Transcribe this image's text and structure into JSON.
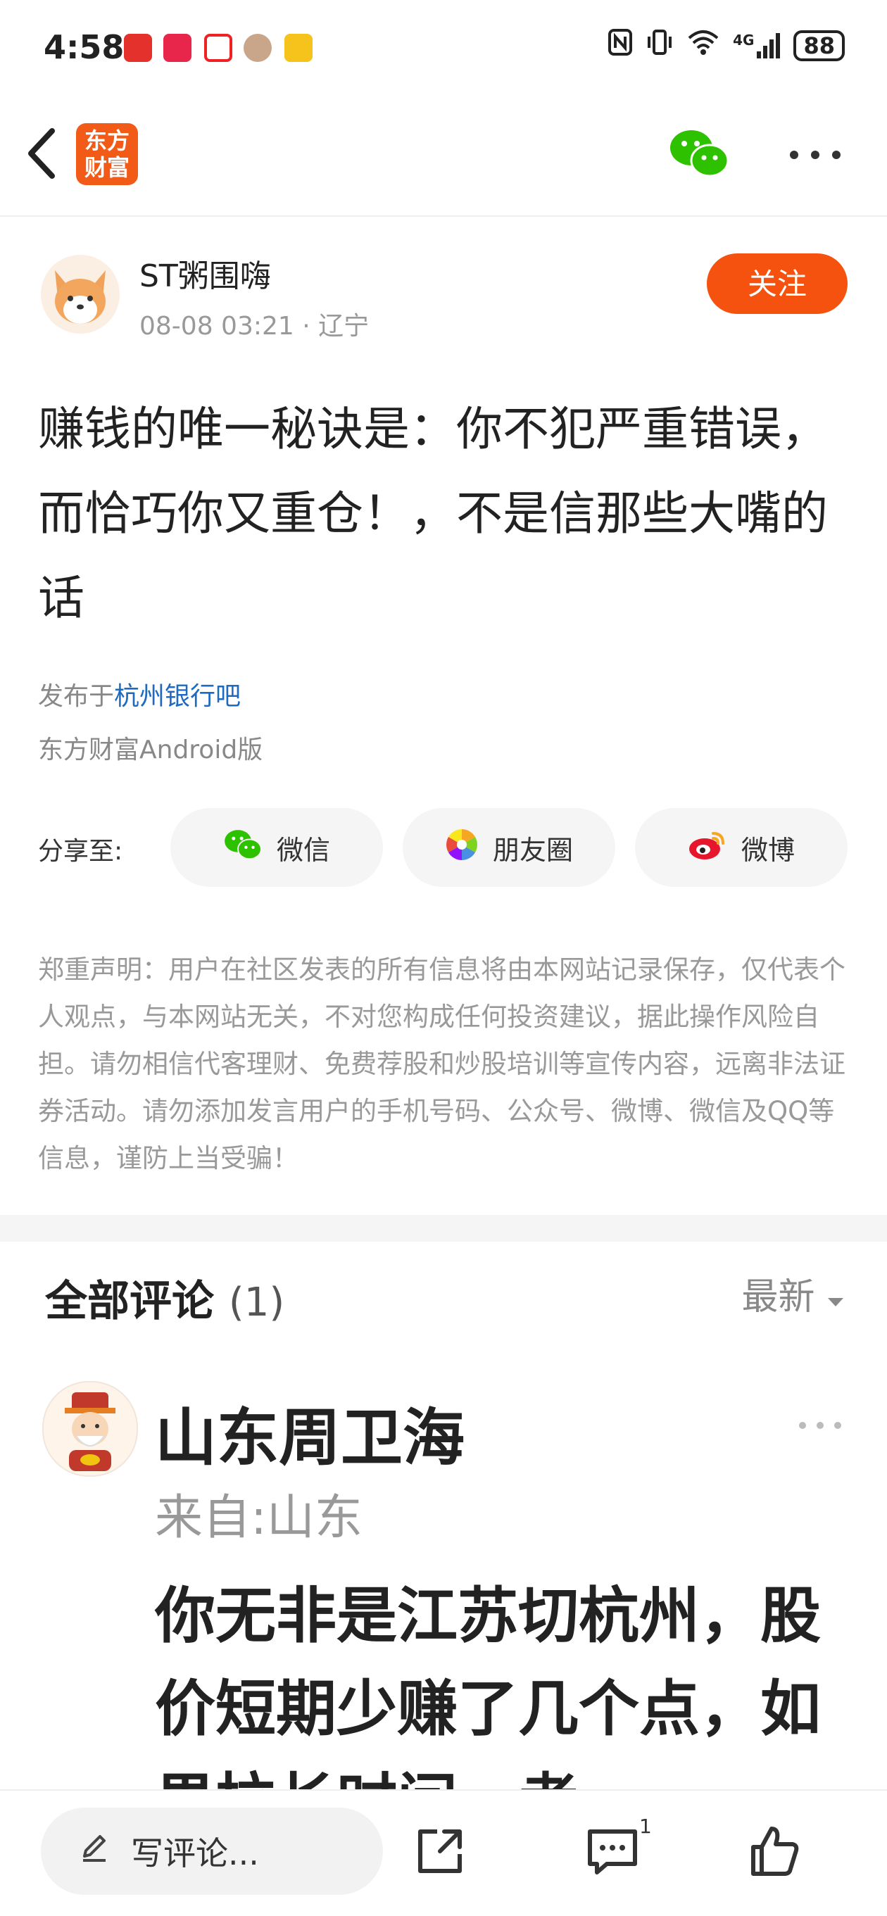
{
  "status_bar": {
    "time": "4:58",
    "battery": "88",
    "network": "4G",
    "icons": [
      "stock-app-icon",
      "hongbao-app-icon",
      "video-app-icon",
      "avatar-app-icon",
      "weibo-app-icon",
      "nfc-icon",
      "vibrate-icon",
      "wifi-icon",
      "signal-icon",
      "battery-icon"
    ]
  },
  "header": {
    "logo_line1": "东方",
    "logo_line2": "财富",
    "icons": [
      "back-icon",
      "wechat-icon",
      "more-icon"
    ]
  },
  "author": {
    "name": "ST粥围嗨",
    "meta": "08-08 03:21 · 辽宁",
    "follow_label": "关注"
  },
  "post": {
    "text": "赚钱的唯一秘诀是：你不犯严重错误，而恰巧你又重仓！，不是信那些大嘴的话",
    "published_prefix": "发布于",
    "published_bar": "杭州银行吧",
    "platform": "东方财富Android版"
  },
  "share": {
    "label": "分享至:",
    "buttons": [
      {
        "label": "微信",
        "icon": "wechat-icon"
      },
      {
        "label": "朋友圈",
        "icon": "moments-icon"
      },
      {
        "label": "微博",
        "icon": "weibo-icon"
      }
    ]
  },
  "disclaimer": "郑重声明：用户在社区发表的所有信息将由本网站记录保存，仅代表个人观点，与本网站无关，不对您构成任何投资建议，据此操作风险自担。请勿相信代客理财、免费荐股和炒股培训等宣传内容，远离非法证券活动。请勿添加发言用户的手机号码、公众号、微博、微信及QQ等信息，谨防上当受骗！",
  "comments": {
    "title": "全部评论",
    "count": "(1)",
    "sort_label": "最新",
    "items": [
      {
        "user": "山东周卫海",
        "location": "来自:山东",
        "text": "你无非是江苏切杭州，股价短期少赚了几个点，如果拉长时间，考"
      }
    ]
  },
  "bottom_bar": {
    "write_placeholder": "写评论...",
    "comment_count": "1",
    "icons": [
      "pencil-icon",
      "share-out-icon",
      "comment-icon",
      "like-icon"
    ]
  },
  "colors": {
    "accent": "#f5520f",
    "link": "#1e6ac0",
    "wechat": "#2dc100",
    "weibo": "#e6162d"
  }
}
